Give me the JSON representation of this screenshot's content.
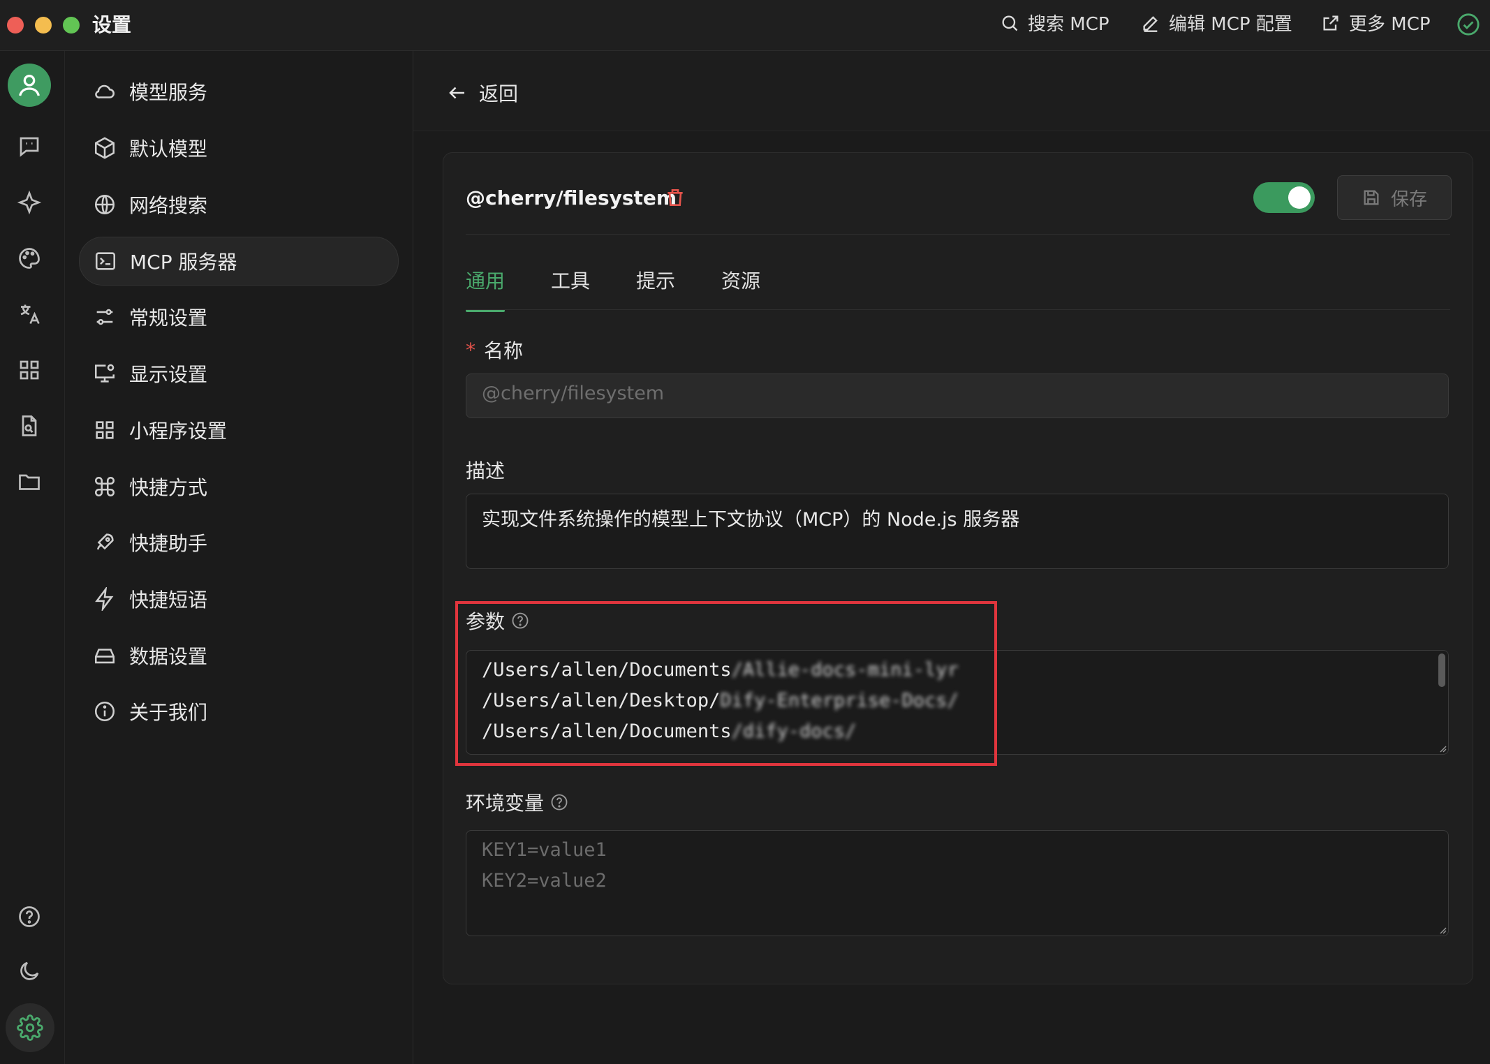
{
  "window": {
    "title": "设置"
  },
  "top_actions": {
    "search": "搜索 MCP",
    "edit": "编辑 MCP 配置",
    "more": "更多 MCP"
  },
  "rail": {
    "icons": [
      "user-avatar-icon",
      "chat-icon",
      "sparkle-icon",
      "palette-icon",
      "translate-icon",
      "apps-icon",
      "file-search-icon",
      "folder-icon",
      "help-icon",
      "moon-icon",
      "gear-icon"
    ]
  },
  "menu": {
    "items": [
      {
        "label": "模型服务",
        "icon": "cloud-icon"
      },
      {
        "label": "默认模型",
        "icon": "cube-icon"
      },
      {
        "label": "网络搜索",
        "icon": "globe-icon"
      },
      {
        "label": "MCP 服务器",
        "icon": "terminal-icon",
        "active": true
      },
      {
        "label": "常规设置",
        "icon": "sliders-icon"
      },
      {
        "label": "显示设置",
        "icon": "monitor-settings-icon"
      },
      {
        "label": "小程序设置",
        "icon": "grid-icon"
      },
      {
        "label": "快捷方式",
        "icon": "command-icon"
      },
      {
        "label": "快捷助手",
        "icon": "rocket-icon"
      },
      {
        "label": "快捷短语",
        "icon": "zap-icon"
      },
      {
        "label": "数据设置",
        "icon": "hard-drive-icon"
      },
      {
        "label": "关于我们",
        "icon": "info-icon"
      }
    ]
  },
  "main": {
    "back_label": "返回",
    "server_name": "@cherry/filesystem",
    "enabled": true,
    "save_label": "保存",
    "tabs": [
      "通用",
      "工具",
      "提示",
      "资源"
    ],
    "active_tab": "通用",
    "form": {
      "name_label": "名称",
      "name_required_mark": "*",
      "name_placeholder": "@cherry/filesystem",
      "description_label": "描述",
      "description_value": "实现文件系统操作的模型上下文协议（MCP）的 Node.js 服务器",
      "args_label": "参数",
      "args_lines": [
        {
          "visible": "/Users/allen/Documents",
          "redacted": "/Allie-docs-mini-lyr"
        },
        {
          "visible": "/Users/allen/Desktop/",
          "redacted": "Dify-Enterprise-Docs/"
        },
        {
          "visible": "/Users/allen/Documents",
          "redacted": "/dify-docs/"
        }
      ],
      "env_label": "环境变量",
      "env_placeholder_lines": [
        "KEY1=value1",
        "KEY2=value2"
      ]
    }
  },
  "colors": {
    "accent": "#4aa96c",
    "highlight_box": "#e0353d",
    "danger": "#e5534b"
  }
}
